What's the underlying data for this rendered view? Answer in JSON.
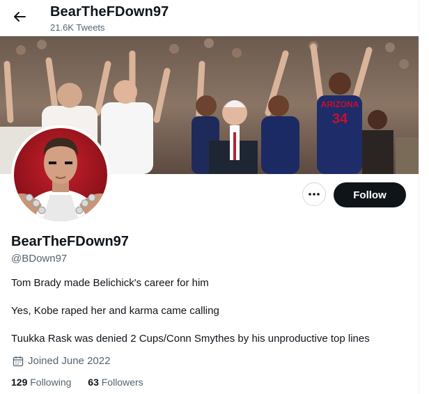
{
  "header": {
    "title": "BearTheFDown97",
    "tweet_count": "21.6K Tweets"
  },
  "profile": {
    "display_name": "BearTheFDown97",
    "handle": "@BDown97",
    "bio": [
      "Tom Brady made Belichick's career for him",
      "Yes, Kobe raped her and karma came calling",
      "Tuukka Rask was denied 2 Cups/Conn Smythes by his unproductive top lines"
    ],
    "joined": "Joined June 2022",
    "following_count": "129",
    "following_label": "Following",
    "followers_count": "63",
    "followers_label": "Followers"
  },
  "actions": {
    "follow_label": "Follow",
    "more_icon": "more-horizontal-icon",
    "back_icon": "back-arrow-icon"
  },
  "banner": {
    "jersey_text": "ARIZONA",
    "jersey_number": "34"
  },
  "colors": {
    "text_primary": "#0f1419",
    "text_secondary": "#536471",
    "follow_bg": "#0f1419",
    "border": "#cfd9de"
  }
}
